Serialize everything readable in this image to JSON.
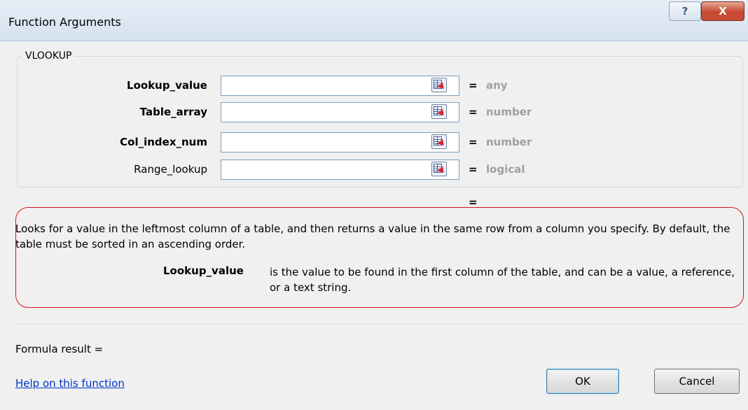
{
  "window": {
    "title": "Function Arguments",
    "help_button": "?",
    "close_button": "X"
  },
  "function_group": {
    "label": "VLOOKUP",
    "arguments": [
      {
        "name": "Lookup_value",
        "value": "",
        "equals": "=",
        "type": "any",
        "required": true
      },
      {
        "name": "Table_array",
        "value": "",
        "equals": "=",
        "type": "number",
        "required": true
      },
      {
        "name": "Col_index_num",
        "value": "",
        "equals": "=",
        "type": "number",
        "required": true
      },
      {
        "name": "Range_lookup",
        "value": "",
        "equals": "=",
        "type": "logical",
        "required": false
      }
    ],
    "result_equals": "="
  },
  "description": {
    "text": "Looks for a value in the leftmost column of a table, and then returns a value in the same row from a column you specify. By default, the table must be sorted in an ascending order.",
    "arg_name": "Lookup_value",
    "arg_help": "is the value to be found in the first column of the table, and can be a value, a reference, or a text string."
  },
  "footer": {
    "formula_result": "Formula result =",
    "help_link": "Help on this function",
    "ok_label": "OK",
    "cancel_label": "Cancel"
  },
  "colors": {
    "highlight_border": "#d4141e",
    "link": "#0033cc",
    "type_text": "#a0a0a0"
  }
}
